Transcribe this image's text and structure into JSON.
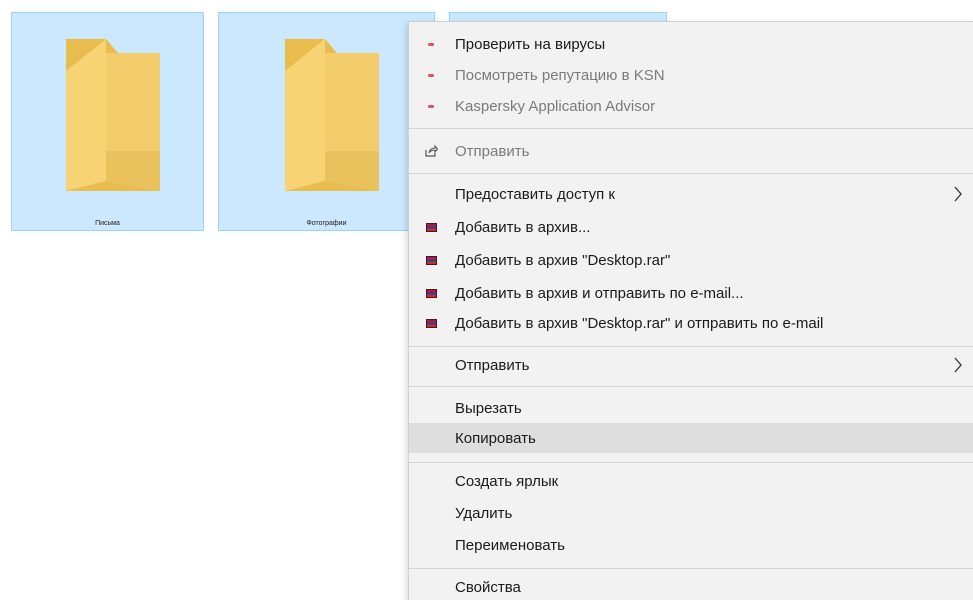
{
  "desktop": {
    "folders": [
      {
        "label": "Письма"
      },
      {
        "label": "Фотографии"
      },
      {
        "label": ""
      }
    ]
  },
  "context_menu": {
    "items": [
      {
        "label": "Проверить на вирусы",
        "icon": "kaspersky-icon"
      },
      {
        "label": "Посмотреть репутацию в KSN",
        "icon": "kaspersky-icon",
        "disabled": true
      },
      {
        "label": "Kaspersky Application Advisor",
        "icon": "kaspersky-icon",
        "disabled": true
      },
      {
        "label": "Отправить",
        "icon": "share-icon",
        "disabled": true
      },
      {
        "label": "Предоставить доступ к",
        "has_submenu": true
      },
      {
        "label": "Добавить в архив...",
        "icon": "winrar-icon"
      },
      {
        "label": "Добавить в архив \"Desktop.rar\"",
        "icon": "winrar-icon"
      },
      {
        "label": "Добавить в архив и отправить по e-mail...",
        "icon": "winrar-icon"
      },
      {
        "label": "Добавить в архив \"Desktop.rar\" и отправить по e-mail",
        "icon": "winrar-icon"
      },
      {
        "label": "Отправить",
        "has_submenu": true
      },
      {
        "label": "Вырезать"
      },
      {
        "label": "Копировать",
        "highlighted": true
      },
      {
        "label": "Создать ярлык"
      },
      {
        "label": "Удалить"
      },
      {
        "label": "Переименовать"
      },
      {
        "label": "Свойства"
      }
    ],
    "submenu_arrow": "›"
  },
  "colors": {
    "selection_fill": "#cce8ff",
    "selection_border": "#99d1ff",
    "menu_bg": "#f2f2f2",
    "highlight": "#dedede"
  }
}
